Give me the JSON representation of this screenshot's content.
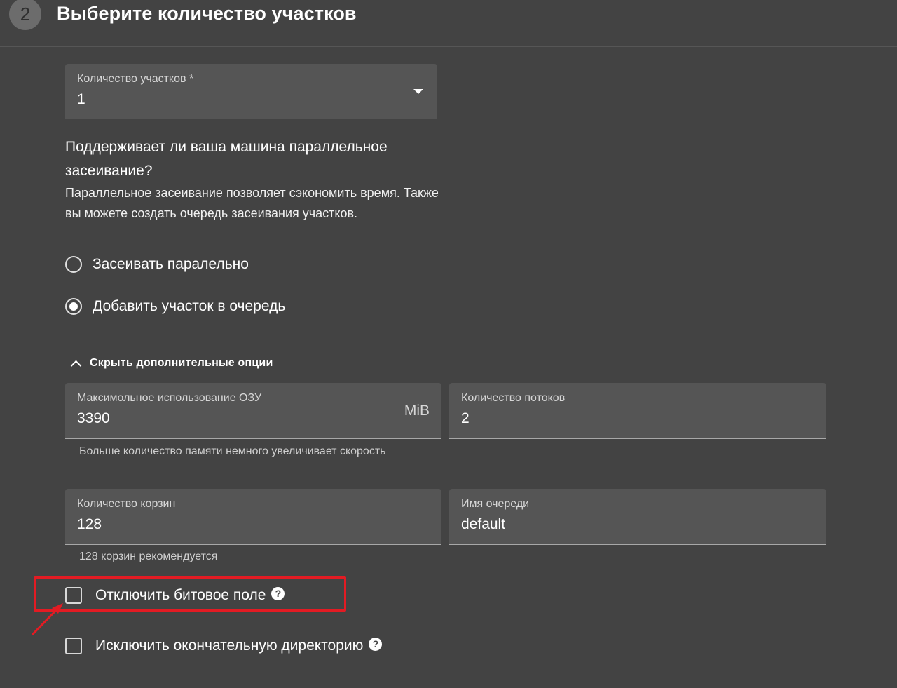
{
  "step": {
    "number": "2",
    "title": "Выберите количество участков"
  },
  "plots_count": {
    "label": "Количество участков *",
    "value": "1"
  },
  "parallel": {
    "question": "Поддерживает ли ваша машина параллельное засеивание?",
    "description": "Параллельное засеивание позволяет сэкономить время. Также вы можете создать очередь засеивания участков.",
    "options": [
      {
        "label": "Засеивать паралельно",
        "checked": false
      },
      {
        "label": "Добавить участок в очередь",
        "checked": true
      }
    ]
  },
  "advanced_toggle": {
    "label": "Скрыть дополнительные опции"
  },
  "ram": {
    "label": "Максимольное использование ОЗУ",
    "value": "3390",
    "suffix": "MiB",
    "hint": "Больше количество памяти немного увеличивает скорость"
  },
  "threads": {
    "label": "Количество потоков",
    "value": "2"
  },
  "buckets": {
    "label": "Количество корзин",
    "value": "128",
    "hint": "128 корзин рекомендуется"
  },
  "queue_name": {
    "label": "Имя очереди",
    "value": "default"
  },
  "checkboxes": [
    {
      "label": "Отключить битовое поле",
      "checked": false,
      "help": "?"
    },
    {
      "label": "Исключить окончательную директорию",
      "checked": false,
      "help": "?"
    }
  ],
  "annotation": {
    "color": "#e31b23"
  }
}
